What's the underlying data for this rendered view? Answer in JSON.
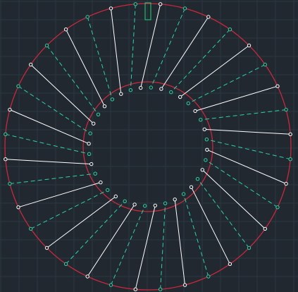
{
  "viewport": {
    "background": "#212830",
    "grid_color": "#2b3742",
    "grid_major_color": "#33404c"
  },
  "drawing": {
    "outer_circle_color": "#c8283c",
    "inner_circle_color": "#c8283c",
    "solid_spoke_color": "#ffffff",
    "dashed_spoke_color": "#2ed3a6",
    "vertex_marker_stroke": "#ffffff",
    "marker_color": "#1fd67a",
    "spoke_pairs": 36
  }
}
